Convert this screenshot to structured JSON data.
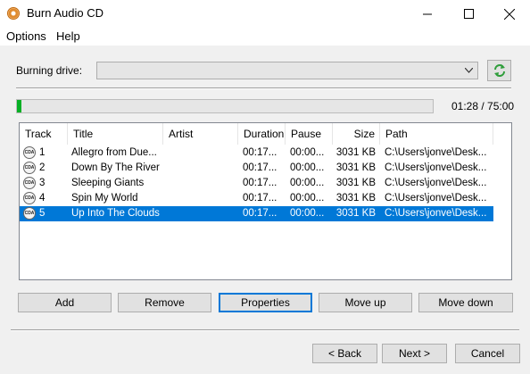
{
  "window": {
    "title": "Burn Audio CD"
  },
  "menu": [
    "Options",
    "Help"
  ],
  "drive": {
    "label": "Burning drive:",
    "value": ""
  },
  "progress": {
    "fraction": 0.0113,
    "time_label": "01:28 / 75:00"
  },
  "table": {
    "columns": [
      "Track",
      "Title",
      "Artist",
      "Duration",
      "Pause",
      "Size",
      "Path"
    ],
    "rows": [
      {
        "track": "1",
        "title": "Allegro from Due...",
        "artist": "",
        "duration": "00:17...",
        "pause": "00:00...",
        "size": "3031 KB",
        "path": "C:\\Users\\jonve\\Desk..."
      },
      {
        "track": "2",
        "title": "Down By The River",
        "artist": "",
        "duration": "00:17...",
        "pause": "00:00...",
        "size": "3031 KB",
        "path": "C:\\Users\\jonve\\Desk..."
      },
      {
        "track": "3",
        "title": "Sleeping Giants",
        "artist": "",
        "duration": "00:17...",
        "pause": "00:00...",
        "size": "3031 KB",
        "path": "C:\\Users\\jonve\\Desk..."
      },
      {
        "track": "4",
        "title": "Spin My World",
        "artist": "",
        "duration": "00:17...",
        "pause": "00:00...",
        "size": "3031 KB",
        "path": "C:\\Users\\jonve\\Desk..."
      },
      {
        "track": "5",
        "title": "Up Into The Clouds",
        "artist": "",
        "duration": "00:17...",
        "pause": "00:00...",
        "size": "3031 KB",
        "path": "C:\\Users\\jonve\\Desk..."
      }
    ],
    "selected_index": 4,
    "track_icon_text": "CDA"
  },
  "buttons": {
    "add": "Add",
    "remove": "Remove",
    "properties": "Properties",
    "move_up": "Move up",
    "move_down": "Move down",
    "back": "< Back",
    "next": "Next >",
    "cancel": "Cancel"
  },
  "colors": {
    "selection": "#0078d7",
    "progress": "#06b025",
    "refresh": "#2e9d3a"
  }
}
